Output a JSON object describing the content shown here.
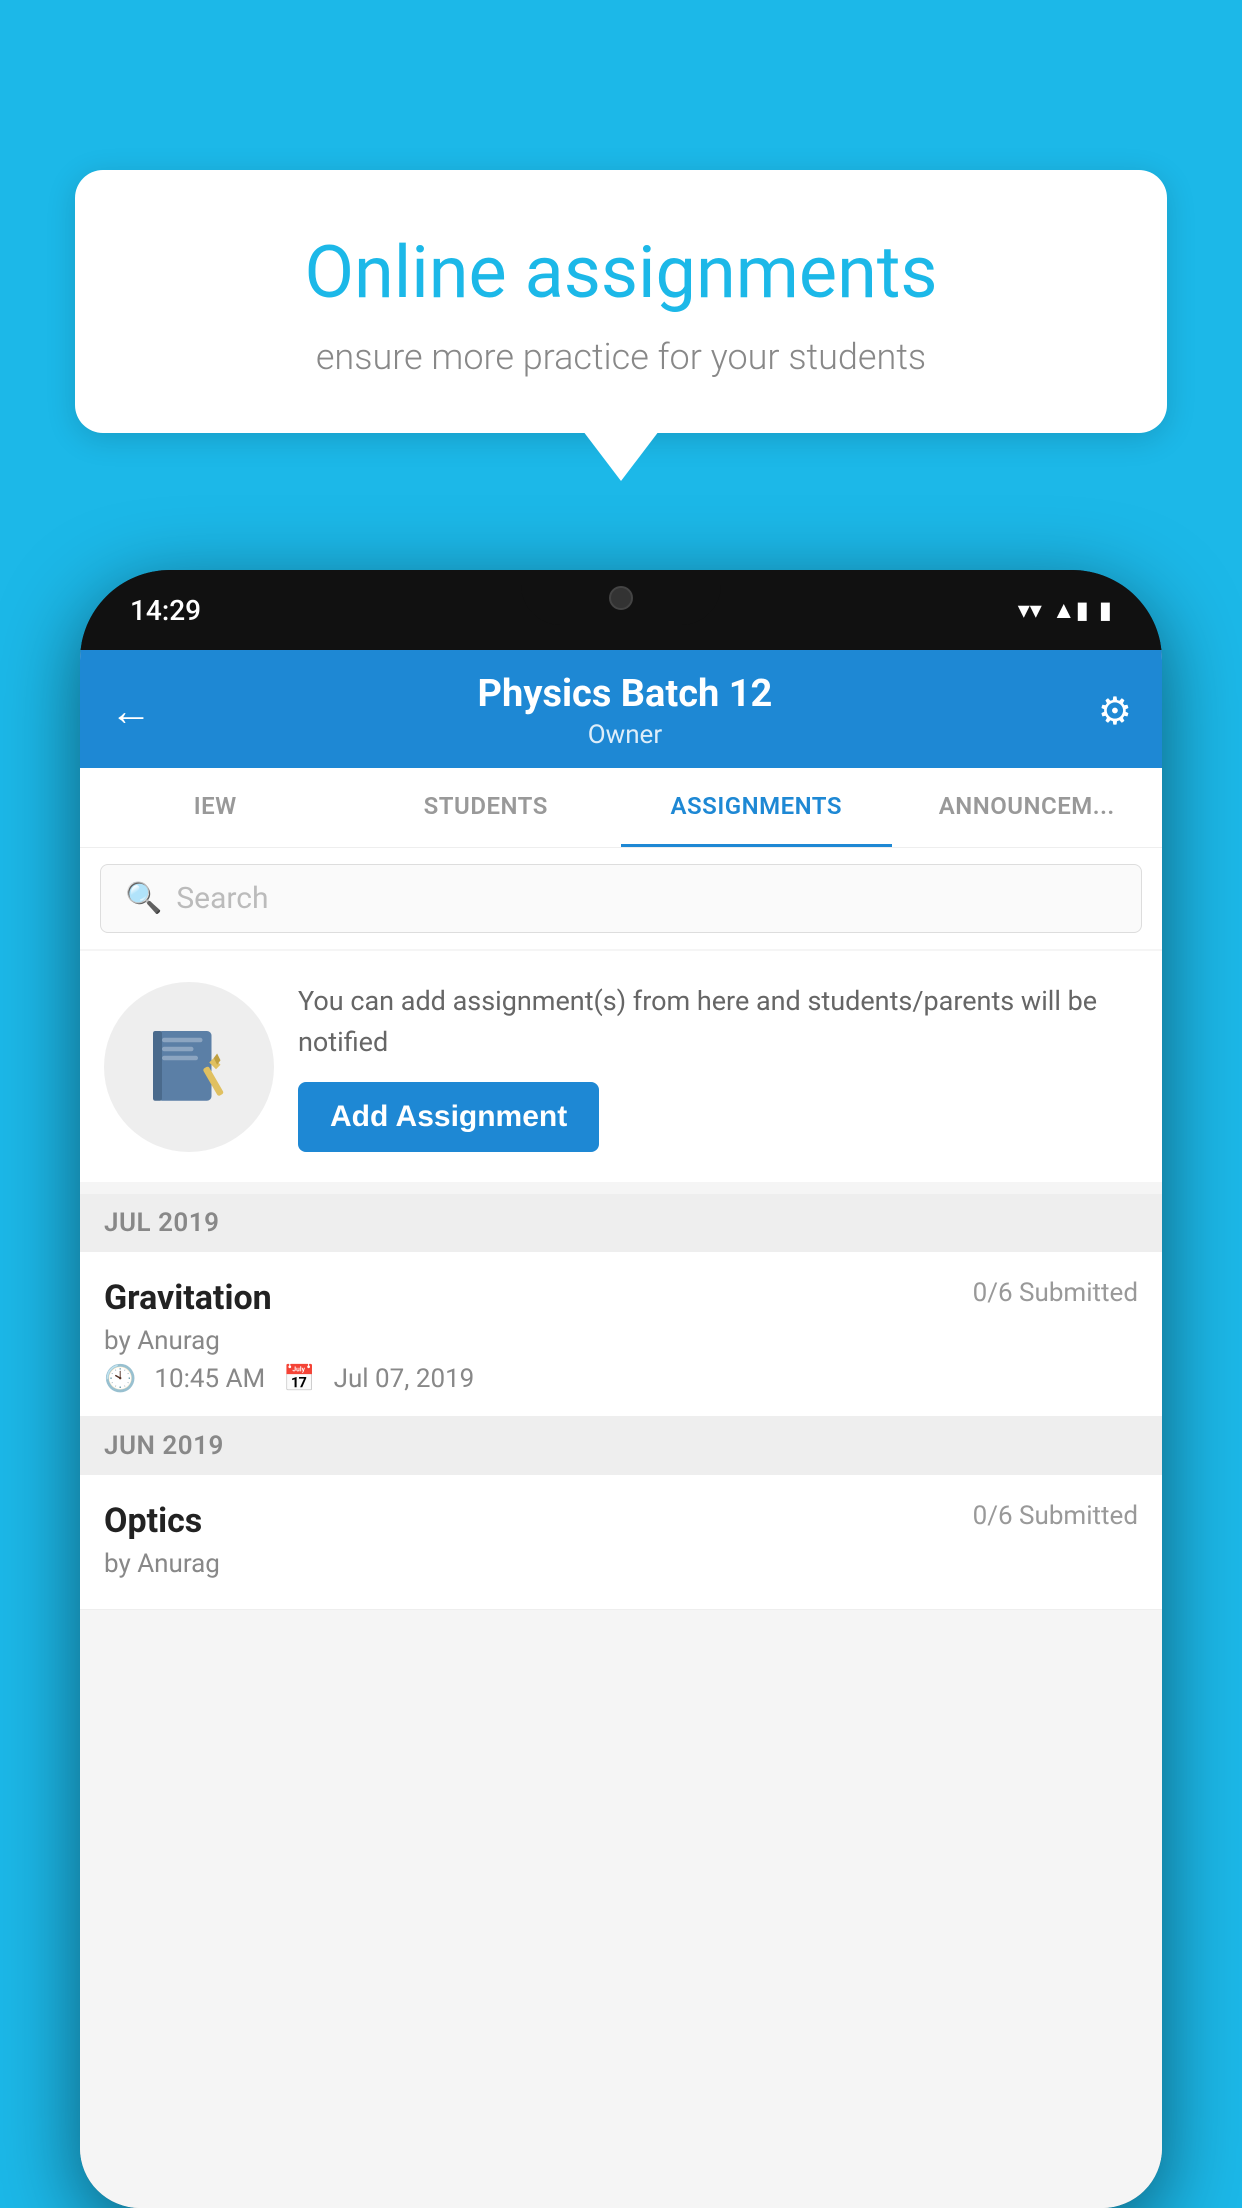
{
  "background": {
    "color": "#1cb8e8"
  },
  "speech_bubble": {
    "title": "Online assignments",
    "subtitle": "ensure more practice for your students"
  },
  "phone": {
    "status_bar": {
      "time": "14:29",
      "wifi": "▾",
      "signal": "▲",
      "battery": "▮"
    },
    "header": {
      "title": "Physics Batch 12",
      "subtitle": "Owner",
      "back_label": "←",
      "settings_label": "⚙"
    },
    "tabs": [
      {
        "label": "IEW",
        "active": false
      },
      {
        "label": "STUDENTS",
        "active": false
      },
      {
        "label": "ASSIGNMENTS",
        "active": true
      },
      {
        "label": "ANNOUNCEM...",
        "active": false
      }
    ],
    "search": {
      "placeholder": "Search"
    },
    "add_assignment_promo": {
      "description": "You can add assignment(s) from here and students/parents will be notified",
      "button_label": "Add Assignment"
    },
    "sections": [
      {
        "month": "JUL 2019",
        "assignments": [
          {
            "name": "Gravitation",
            "submitted": "0/6 Submitted",
            "by": "by Anurag",
            "time": "10:45 AM",
            "date": "Jul 07, 2019"
          }
        ]
      },
      {
        "month": "JUN 2019",
        "assignments": [
          {
            "name": "Optics",
            "submitted": "0/6 Submitted",
            "by": "by Anurag",
            "time": "",
            "date": ""
          }
        ]
      }
    ]
  }
}
